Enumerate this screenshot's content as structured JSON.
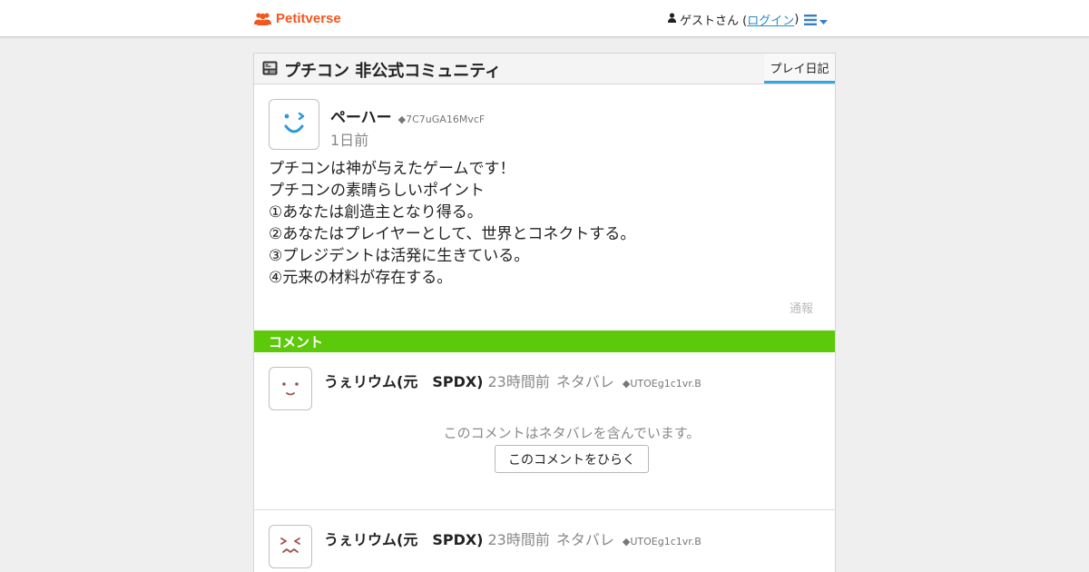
{
  "app": {
    "brand": "Petitverse",
    "brand_color": "#f0581f",
    "user_label": "ゲストさん (",
    "login_link": "ログイン",
    "user_label_close": ")",
    "menu_icon": "hamburger-menu-icon"
  },
  "community": {
    "title": "プチコン 非公式コミュニティ",
    "icon": "petitcom-console-icon",
    "tab_label": "プレイ日記"
  },
  "post": {
    "author": "ペーハー",
    "author_id": "◆7C7uGA16MvcF",
    "time": "1日前",
    "body": "プチコンは神が与えたゲームです！\nプチコンの素晴らしいポイント\n①あなたは創造主となり得る。\n②あなたはプレイヤーとして、世界とコネクトする。\n③プレジデントは活発に生きている。\n④元来の材料が存在する。",
    "report_label": "通報",
    "avatar_expression": "wink"
  },
  "comments_section": {
    "label": "コメント",
    "accent_color": "#5cc90a"
  },
  "comments": [
    {
      "author": "うぇリウム(元　SPDX)",
      "time": "23時間前",
      "spoiler_tag": "ネタバレ",
      "author_id": "◆UTOEg1c1vr.B",
      "spoiler_message": "このコメントはネタバレを含んでいます。",
      "open_button": "このコメントをひらく",
      "avatar_expression": "normal"
    },
    {
      "author": "うぇリウム(元　SPDX)",
      "time": "23時間前",
      "spoiler_tag": "ネタバレ",
      "author_id": "◆UTOEg1c1vr.B",
      "avatar_expression": "frustrated"
    }
  ]
}
